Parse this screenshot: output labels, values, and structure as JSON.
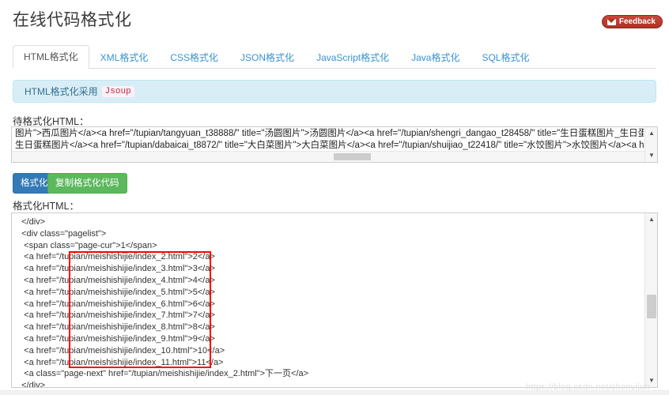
{
  "header": {
    "title": "在线代码格式化",
    "feedback_label": "Feedback",
    "feedback_icon": "envelope-icon",
    "feedback_color": "#c0392b"
  },
  "tabs": [
    {
      "label": "HTML格式化",
      "active": true
    },
    {
      "label": "XML格式化",
      "active": false
    },
    {
      "label": "CSS格式化",
      "active": false
    },
    {
      "label": "JSON格式化",
      "active": false
    },
    {
      "label": "JavaScript格式化",
      "active": false
    },
    {
      "label": "Java格式化",
      "active": false
    },
    {
      "label": "SQL格式化",
      "active": false
    }
  ],
  "alert": {
    "text": "HTML格式化采用",
    "code_link": "Jsoup",
    "bg_color": "#d9edf7",
    "text_color": "#31708f"
  },
  "input_section": {
    "label": "待格式化HTML：",
    "value": "图片\">西瓜图片</a><a href=\"/tupian/tangyuan_t38888/\" title=\"汤圆图片\">汤圆图片</a><a href=\"/tupian/shengri_dangao_t28458/\" title=\"生日蛋糕图片_生日蛋糕图片大全\">\n生日蛋糕图片</a><a href=\"/tupian/dabaicai_t8872/\" title=\"大白菜图片\">大白菜图片</a><a href=\"/tupian/shuijiao_t22418/\" title=\"水饺图片\">水饺图片</a><a href=\"/tupian"
  },
  "buttons": {
    "format_label": "格式化",
    "format_color": "#337ab7",
    "copy_label": "复制格式化代码",
    "copy_color": "#5cb85c"
  },
  "output_section": {
    "label": "格式化HTML：",
    "lines": [
      "  </div>",
      "  <div class=\"pagelist\">",
      "   <span class=\"page-cur\">1</span>",
      "   <a href=\"/tupian/meishishijie/index_2.html\">2</a>",
      "   <a href=\"/tupian/meishishijie/index_3.html\">3</a>",
      "   <a href=\"/tupian/meishishijie/index_4.html\">4</a>",
      "   <a href=\"/tupian/meishishijie/index_5.html\">5</a>",
      "   <a href=\"/tupian/meishishijie/index_6.html\">6</a>",
      "   <a href=\"/tupian/meishishijie/index_7.html\">7</a>",
      "   <a href=\"/tupian/meishishijie/index_8.html\">8</a>",
      "   <a href=\"/tupian/meishishijie/index_9.html\">9</a>",
      "   <a href=\"/tupian/meishishijie/index_10.html\">10</a>",
      "   <a href=\"/tupian/meishishijie/index_11.html\">11</a>",
      "   <a class=\"page-next\" href=\"/tupian/meishishijie/index_2.html\">下一页</a>",
      "  </div>"
    ]
  },
  "annotation": {
    "shape": "rectangle",
    "color": "#ff0000",
    "describes": "href attribute values of the pagination links"
  },
  "scrollbars": {
    "up_arrow": "▲",
    "down_arrow": "▼"
  },
  "watermark": {
    "text": "https://blog.csdn.net/chenyijun"
  }
}
